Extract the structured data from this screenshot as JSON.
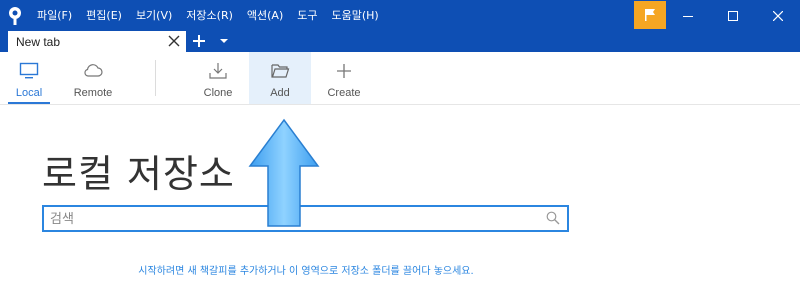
{
  "menu": {
    "items": [
      "파일(F)",
      "편집(E)",
      "보기(V)",
      "저장소(R)",
      "액션(A)",
      "도구",
      "도움말(H)"
    ]
  },
  "tabs": [
    {
      "label": "New tab"
    }
  ],
  "toolbar": {
    "local_label": "Local",
    "remote_label": "Remote",
    "clone_label": "Clone",
    "add_label": "Add",
    "create_label": "Create"
  },
  "main": {
    "title": "로컬 저장소",
    "search_placeholder": "검색",
    "hint": "시작하려면 새 책갈피를 추가하거나 이 영역으로 저장소 폴더를 끌어다 놓으세요."
  },
  "colors": {
    "titlebar": "#0e4fb4",
    "accent": "#2b78d6",
    "flag": "#f5a623"
  }
}
